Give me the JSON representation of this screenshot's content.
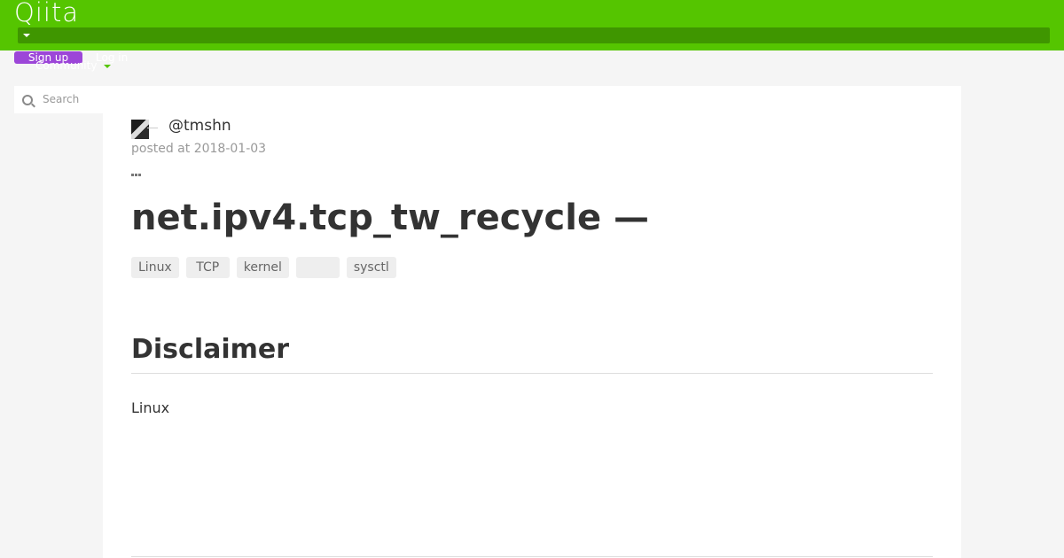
{
  "header": {
    "logo": "Qiita",
    "signup_label": "Sign up",
    "login_label": "Log in",
    "community_label": "Community"
  },
  "search": {
    "placeholder": "Search"
  },
  "article": {
    "author": "@tmshn",
    "posted": "posted at 2018-01-03",
    "title": "net.ipv4.tcp_tw_recycle  —",
    "tags": [
      "Linux",
      "TCP",
      "kernel",
      "",
      "sysctl"
    ],
    "section_heading": "Disclaimer",
    "body_text": "Linux"
  },
  "colors": {
    "header_bg": "#55c500",
    "signup_bg": "#9c46d8"
  }
}
